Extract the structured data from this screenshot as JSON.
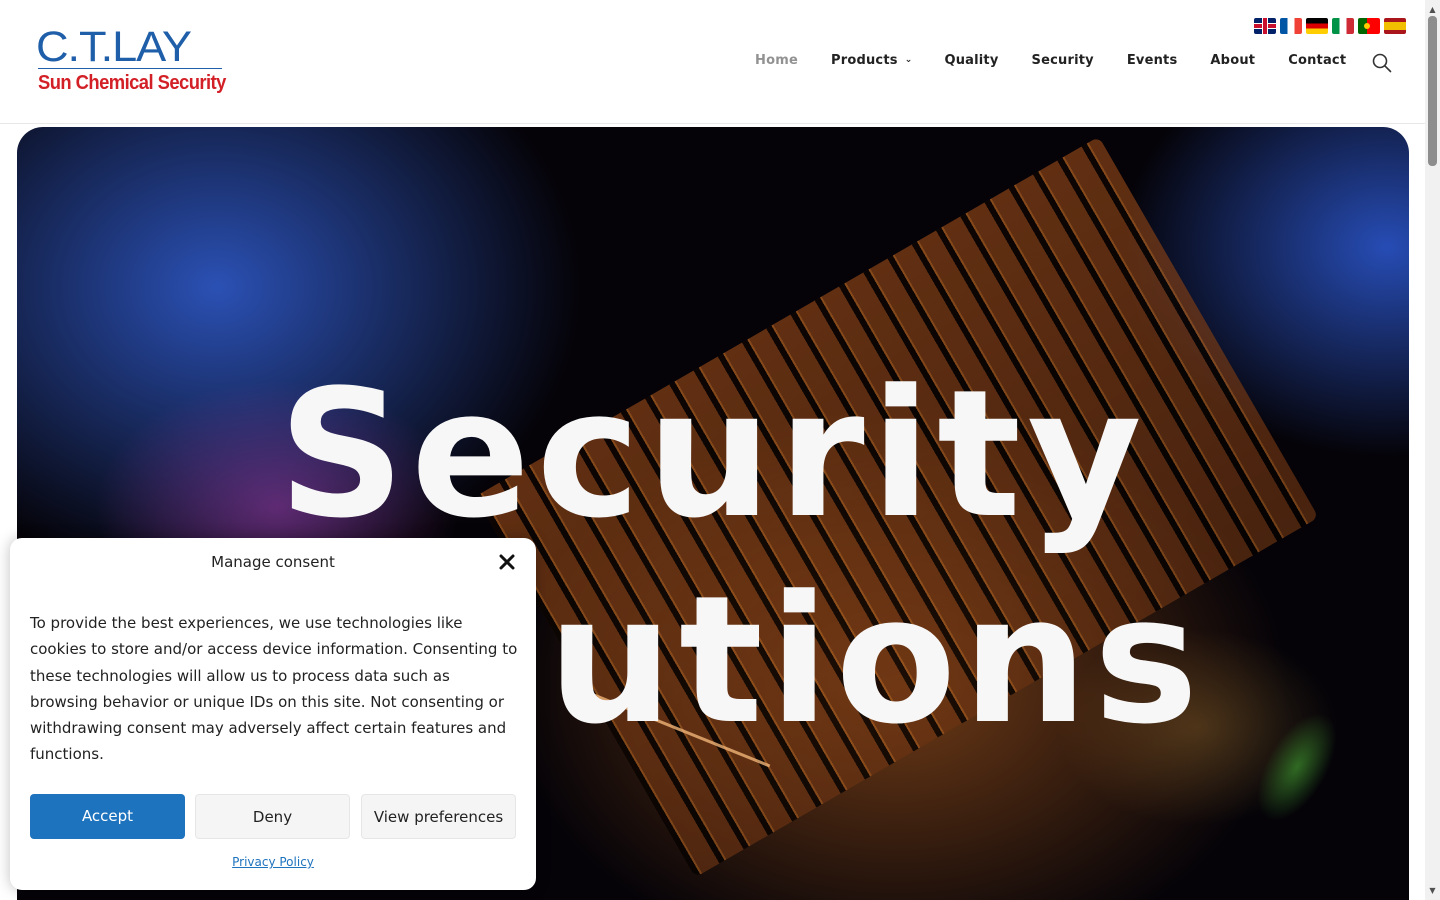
{
  "logo": {
    "top_text": "C.T.LAY",
    "bottom_text": "Sun Chemical Security"
  },
  "languages": [
    "gb-flag-icon",
    "fr-flag-icon",
    "de-flag-icon",
    "it-flag-icon",
    "pt-flag-icon",
    "es-flag-icon"
  ],
  "nav": {
    "items": [
      {
        "label": "Home",
        "active": true
      },
      {
        "label": "Products",
        "has_dropdown": true
      },
      {
        "label": "Quality"
      },
      {
        "label": "Security"
      },
      {
        "label": "Events"
      },
      {
        "label": "About"
      },
      {
        "label": "Contact"
      }
    ],
    "dropdown_glyph": "⌄",
    "search_icon": "search-icon"
  },
  "hero": {
    "line1": "Security",
    "line2": "Solutions"
  },
  "consent": {
    "title": "Manage consent",
    "body": "To provide the best experiences, we use technologies like cookies to store and/or access device information. Consenting to these technologies will allow us to process data such as browsing behavior or unique IDs on this site. Not consenting or withdrawing consent may adversely affect certain features and functions.",
    "accept": "Accept",
    "deny": "Deny",
    "preferences": "View preferences",
    "privacy_link": "Privacy Policy"
  },
  "colors": {
    "brand_blue": "#1f5ea8",
    "brand_red": "#d32027",
    "accept_blue": "#1e73be"
  }
}
